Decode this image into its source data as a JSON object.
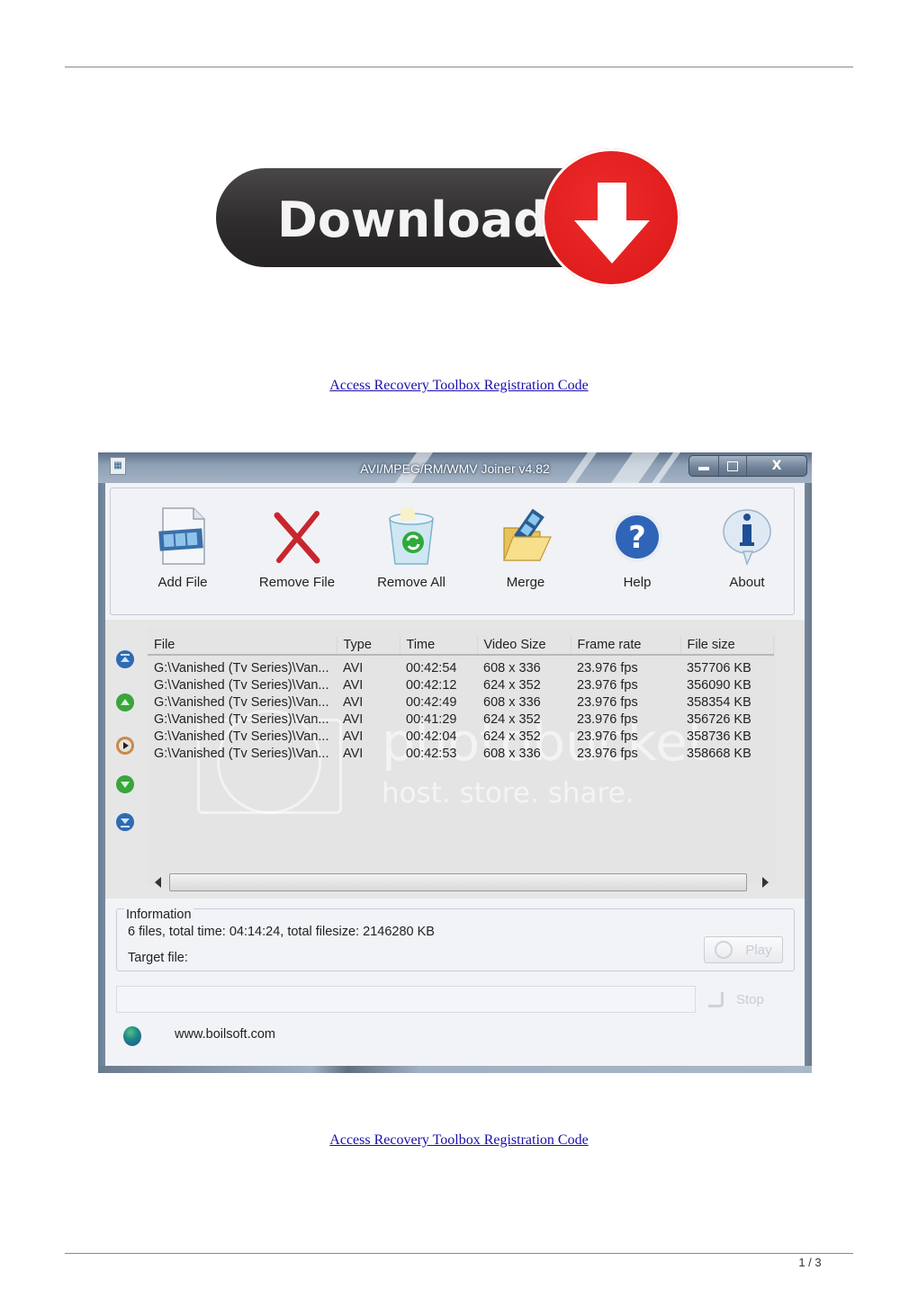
{
  "page": {
    "promo_link_top": "Access Recovery Toolbox Registration Code",
    "promo_link_bottom": "Access Recovery Toolbox Registration Code",
    "page_number": "1 / 3"
  },
  "download_banner": {
    "label": "Download",
    "colors": {
      "pill": "#2f2c2d",
      "circle": "#e01d1d",
      "text": "#f4f4f4"
    }
  },
  "window": {
    "title": "AVI/MPEG/RM/WMV Joiner v4.82",
    "controls": {
      "minimize": "minimize",
      "maximize": "maximize",
      "close": "X"
    },
    "toolbar": [
      {
        "label": "Add File",
        "icon": "film-file-icon"
      },
      {
        "label": "Remove File",
        "icon": "red-x-icon"
      },
      {
        "label": "Remove All",
        "icon": "recycle-bin-icon"
      },
      {
        "label": "Merge",
        "icon": "folder-film-icon"
      },
      {
        "label": "Help",
        "icon": "question-icon"
      },
      {
        "label": "About",
        "icon": "info-icon"
      }
    ],
    "side_buttons": [
      {
        "name": "move-top",
        "icon": "move-top-icon"
      },
      {
        "name": "move-up",
        "icon": "move-up-icon"
      },
      {
        "name": "play-preview",
        "icon": "play-preview-icon"
      },
      {
        "name": "move-down",
        "icon": "move-down-icon"
      },
      {
        "name": "move-bottom",
        "icon": "move-bottom-icon"
      }
    ],
    "table": {
      "columns": [
        "File",
        "Type",
        "Time",
        "Video Size",
        "Frame rate",
        "File size"
      ],
      "rows": [
        {
          "file": "G:\\Vanished (Tv Series)\\Van...",
          "type": "AVI",
          "time": "00:42:54",
          "video_size": "608 x 336",
          "frame_rate": "23.976 fps",
          "file_size": "357706 KB"
        },
        {
          "file": "G:\\Vanished (Tv Series)\\Van...",
          "type": "AVI",
          "time": "00:42:12",
          "video_size": "624 x 352",
          "frame_rate": "23.976 fps",
          "file_size": "356090 KB"
        },
        {
          "file": "G:\\Vanished (Tv Series)\\Van...",
          "type": "AVI",
          "time": "00:42:49",
          "video_size": "608 x 336",
          "frame_rate": "23.976 fps",
          "file_size": "358354 KB"
        },
        {
          "file": "G:\\Vanished (Tv Series)\\Van...",
          "type": "AVI",
          "time": "00:41:29",
          "video_size": "624 x 352",
          "frame_rate": "23.976 fps",
          "file_size": "356726 KB"
        },
        {
          "file": "G:\\Vanished (Tv Series)\\Van...",
          "type": "AVI",
          "time": "00:42:04",
          "video_size": "624 x 352",
          "frame_rate": "23.976 fps",
          "file_size": "358736 KB"
        },
        {
          "file": "G:\\Vanished (Tv Series)\\Van...",
          "type": "AVI",
          "time": "00:42:53",
          "video_size": "608 x 336",
          "frame_rate": "23.976 fps",
          "file_size": "358668 KB"
        }
      ]
    },
    "watermark": {
      "line1": "photobucket",
      "line2": "host. store. share."
    },
    "info": {
      "legend": "Information",
      "summary": "6 files, total time: 04:14:24, total filesize: 2146280 KB",
      "target_label": "Target file:",
      "play_label": "Play"
    },
    "progress": {
      "value": 0
    },
    "stop_label": "Stop",
    "website": "www.boilsoft.com"
  }
}
